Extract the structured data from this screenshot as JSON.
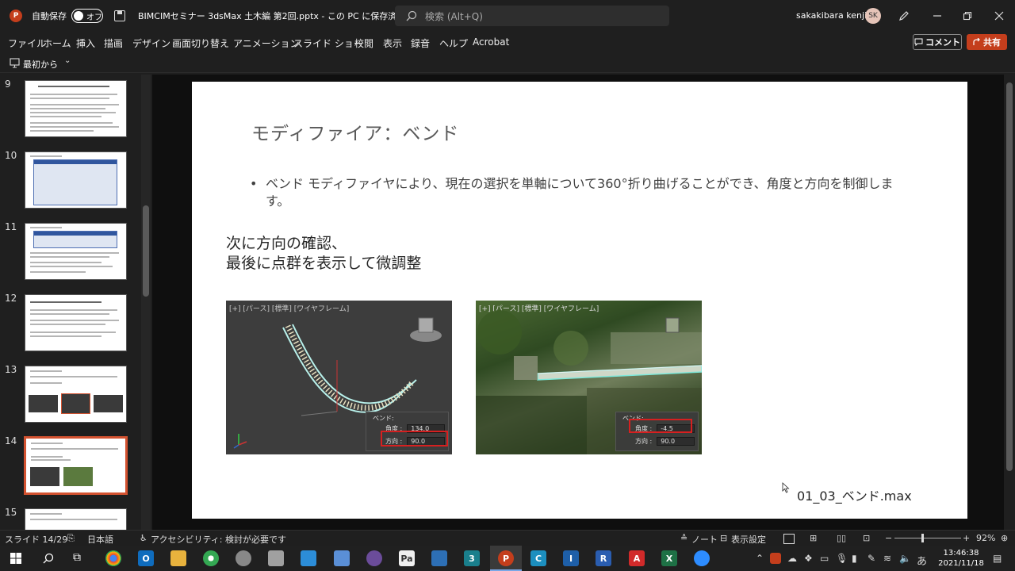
{
  "titlebar": {
    "autosave_label": "自動保存",
    "autosave_state": "オフ",
    "doc_title": "BIMCIMセミナー 3dsMax 土木編 第2回.pptx - この PC に保存済み ⌄",
    "search_placeholder": "検索 (Alt+Q)",
    "user_name": "sakakibara kenji",
    "user_initials": "SK",
    "app_icon": "P"
  },
  "menu": {
    "items": [
      "ファイル",
      "ホーム",
      "挿入",
      "描画",
      "デザイン",
      "画面切り替え",
      "アニメーション",
      "スライド ショー",
      "校閲",
      "表示",
      "録音",
      "ヘルプ",
      "Acrobat"
    ],
    "comment_label": "コメント",
    "share_label": "共有"
  },
  "quickbar": {
    "from_start_label": "最初から"
  },
  "thumbnails": {
    "numbers": [
      "9",
      "10",
      "11",
      "12",
      "13",
      "14",
      "15"
    ],
    "selected": "14"
  },
  "slide": {
    "title": "モディファイア：ベンド",
    "bullet": "ベンド モディファイヤにより、現在の選択を単軸について360°折り曲げることができ、角度と方向を制御します。",
    "sub_line1": "次に方向の確認、",
    "sub_line2": "最後に点群を表示して微調整",
    "filename": "01_03_ベンド.max",
    "viewport1": {
      "label": "[+] [パース] [標準] [ワイヤフレーム]",
      "panel_title": "ベンド:",
      "angle_label": "角度 :",
      "angle_value": "134.0",
      "direction_label": "方向 :",
      "direction_value": "90.0"
    },
    "viewport2": {
      "label": "[+] [パース] [標準] [ワイヤフレーム]",
      "panel_title": "ベンド:",
      "angle_label": "角度 :",
      "angle_value": "-4.5",
      "direction_label": "方向 :",
      "direction_value": "90.0"
    }
  },
  "statusbar": {
    "slide_info": "スライド 14/29",
    "language": "日本語",
    "accessibility": "アクセシビリティ: 検討が必要です",
    "notes": "ノート",
    "display_settings": "表示設定",
    "zoom": "92%"
  },
  "taskbar": {
    "time": "13:46:38",
    "date": "2021/11/18",
    "ime": "あ"
  },
  "colors": {
    "accent": "#c43e1c",
    "selected_border": "#d35230",
    "highlight_red": "#d62020"
  }
}
